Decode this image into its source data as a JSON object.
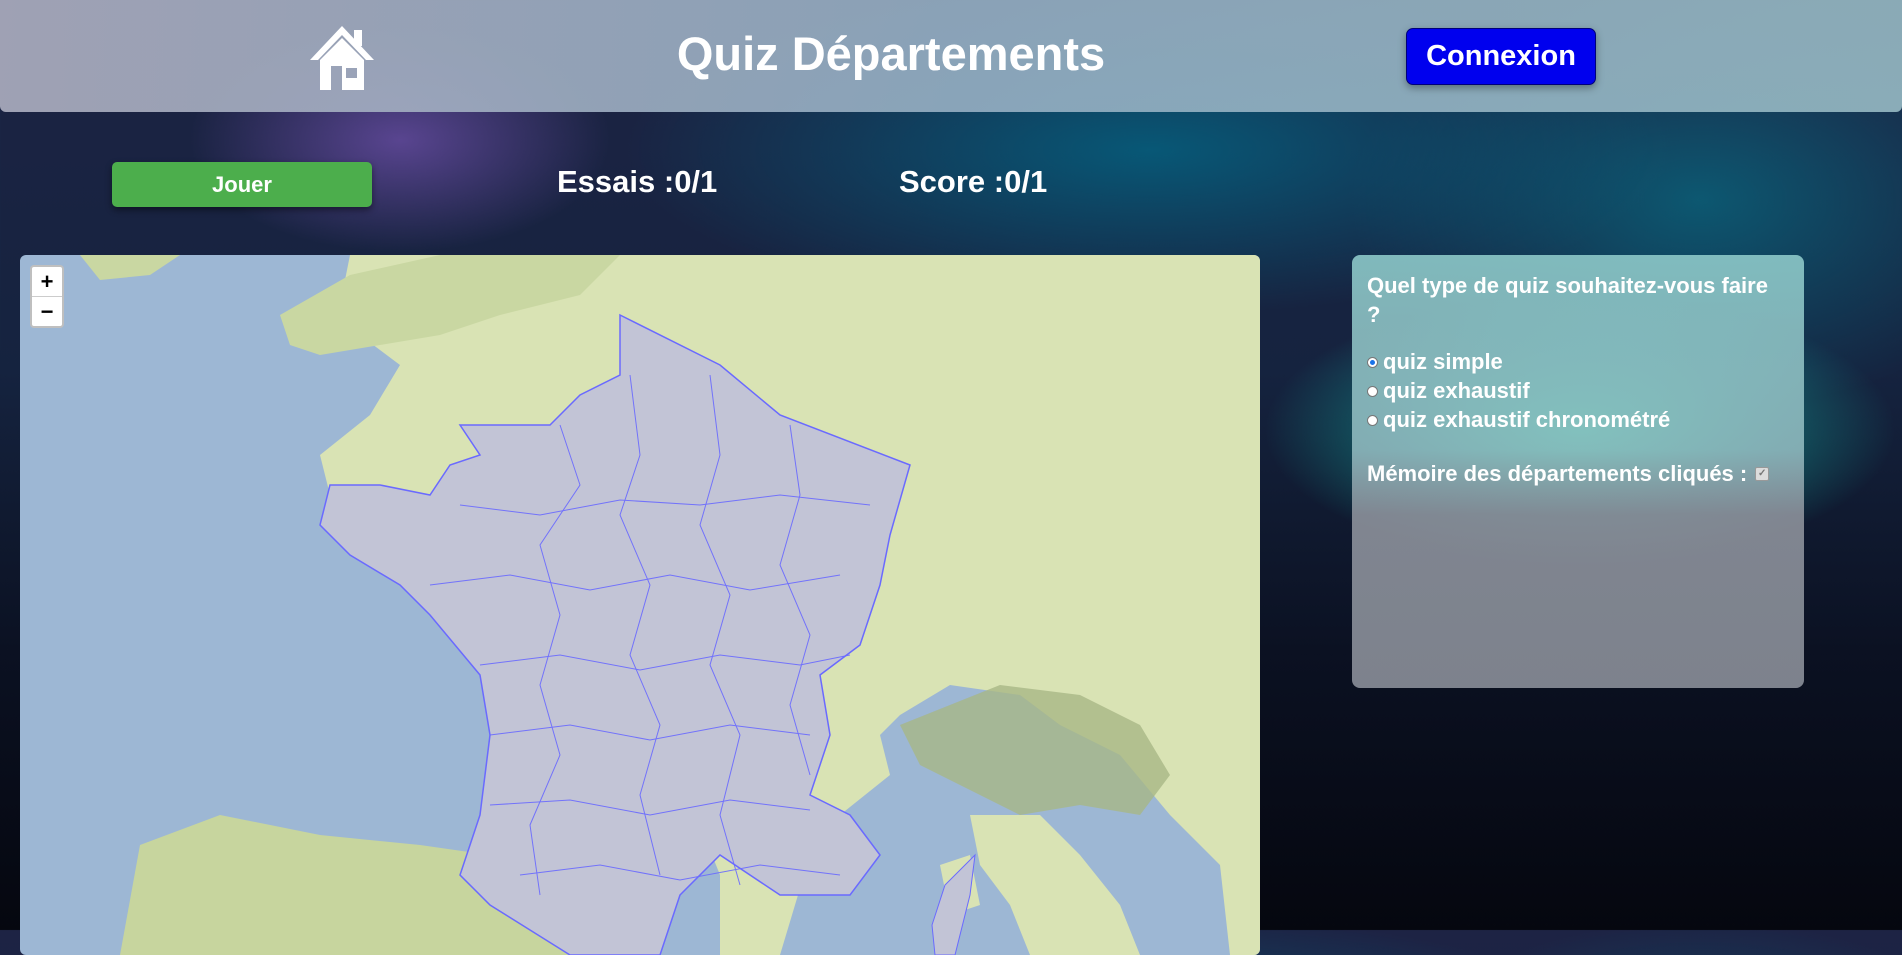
{
  "header": {
    "title": "Quiz Départements",
    "connexion_label": "Connexion",
    "home_icon": "home-icon"
  },
  "controls": {
    "jouer_label": "Jouer",
    "essais": "Essais :0/1",
    "score": "Score :0/1"
  },
  "map": {
    "zoom_in": "+",
    "zoom_out": "−"
  },
  "panel": {
    "question": "Quel type de quiz souhaitez-vous faire ?",
    "options": [
      {
        "label": "quiz simple",
        "selected": true
      },
      {
        "label": "quiz exhaustif",
        "selected": false
      },
      {
        "label": "quiz exhaustif chronométré",
        "selected": false
      }
    ],
    "memoire_label": "Mémoire des départements cliqués :",
    "memoire_checked": true
  },
  "colors": {
    "connexion_bg": "#0000ee",
    "jouer_bg": "#4cae4c",
    "department_border": "#6a6aff"
  }
}
